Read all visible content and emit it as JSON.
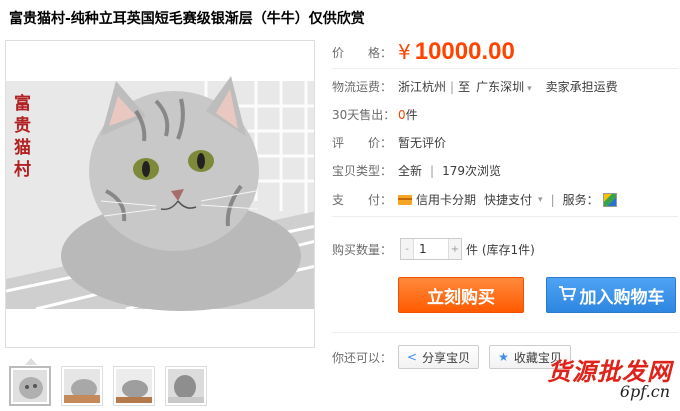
{
  "title": "富贵猫村-纯种立耳英国短毛赛级银渐层（牛牛）仅供欣赏",
  "price": {
    "label": "价　　格：",
    "symbol": "¥",
    "value": "10000.00"
  },
  "shipping": {
    "label": "物流运费：",
    "from": "浙江杭州",
    "to_prefix": "至",
    "to": "广东深圳",
    "note": "卖家承担运费"
  },
  "sales": {
    "label": "30天售出：",
    "count": "0",
    "unit": "件"
  },
  "rating": {
    "label": "评　　价：",
    "value": "暂无评价"
  },
  "type": {
    "label": "宝贝类型：",
    "condition": "全新",
    "views": "179次浏览"
  },
  "payment": {
    "label": "支　　付：",
    "installment": "信用卡分期",
    "quickpay": "快捷支付",
    "service_label": "服务："
  },
  "quantity": {
    "label": "购买数量：",
    "value": "1",
    "stock": "件 (库存1件)"
  },
  "buttons": {
    "buy_now": "立刻购买",
    "add_cart": "加入购物车"
  },
  "share": {
    "label": "你还可以：",
    "share_btn": "分享宝贝",
    "fav_btn": "收藏宝贝"
  },
  "image_overlay_text": "富贵猫村",
  "watermark": {
    "site_cn": "货源批发网",
    "url": "6pf.cn"
  },
  "colors": {
    "accent": "#ff4400",
    "buy": "#ff5a00",
    "cart": "#2d86e0"
  }
}
